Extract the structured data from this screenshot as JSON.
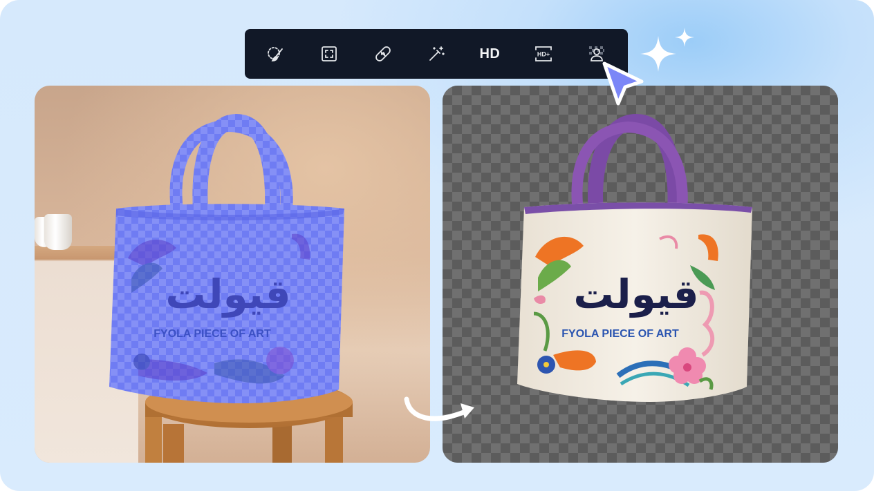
{
  "toolbar": {
    "tools": [
      {
        "name": "magic-brush-tool",
        "label": ""
      },
      {
        "name": "crop-tool",
        "label": ""
      },
      {
        "name": "retouch-tool",
        "label": ""
      },
      {
        "name": "magic-wand-tool",
        "label": ""
      },
      {
        "name": "hd-tool",
        "label": "HD"
      },
      {
        "name": "hd-plus-tool",
        "label": "HD+"
      },
      {
        "name": "remove-background-tool",
        "label": ""
      }
    ]
  },
  "left_panel": {
    "bag_arabic_text": "قيولت",
    "bag_caption": "FYOLA PIECE OF ART"
  },
  "right_panel": {
    "bag_arabic_text": "قيولت",
    "bag_caption": "FYOLA PIECE OF ART"
  },
  "colors": {
    "toolbar_bg": "#111827",
    "mask_overlay": "#6b77f2",
    "cursor": "#7b86f7",
    "bag_text": "#1b1f4a"
  }
}
